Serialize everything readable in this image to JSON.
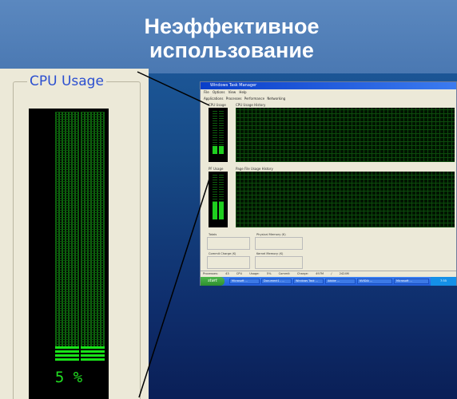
{
  "slide": {
    "title_line1": "Неэффективное",
    "title_line2": "использование"
  },
  "cpu_panel": {
    "legend": "CPU Usage",
    "usage_label": "5 %",
    "usage_percent": 5
  },
  "task_manager": {
    "title": "Windows Task Manager",
    "menu": "File Options View Help",
    "tabs": "Applications Processes Performance Networking",
    "cpu_usage_label": "CPU Usage",
    "cpu_history_label": "CPU Usage History",
    "pf_usage_label": "PF Usage",
    "pf_history_label": "Page File Usage History",
    "totals_label": "Totals",
    "physical_memory_label": "Physical Memory (K)",
    "commit_charge_label": "Commit Charge (K)",
    "kernel_memory_label": "Kernel Memory (K)",
    "status_bar": "Processes: 43   CPU Usage: 5%   Commit Charge: 497M / 2424M",
    "start_label": "start",
    "tray_time": "7:55",
    "taskbar_items": [
      "Microsoft ...",
      "Document1 - ...",
      "Windows Task ...",
      "Adobe ...",
      "NVIDIA ...",
      "Microsoft ..."
    ]
  }
}
